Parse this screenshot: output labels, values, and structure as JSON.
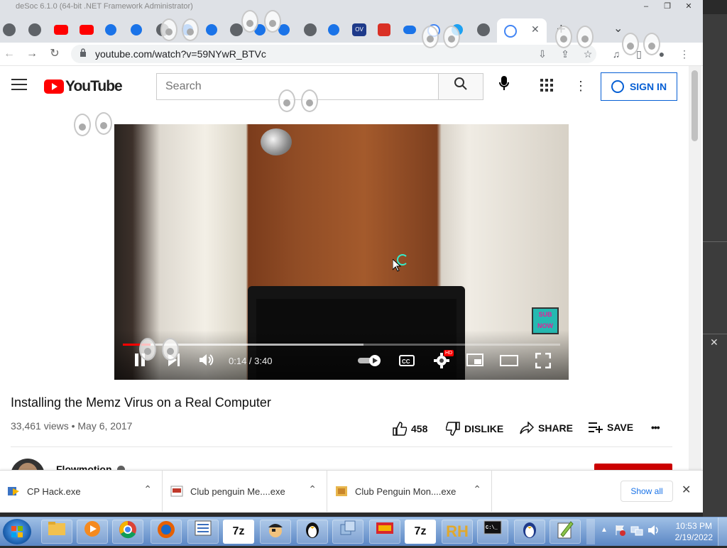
{
  "window": {
    "title": "deSoc 6.1.0 (64-bit .NET Framework Administrator)",
    "minimize": "–",
    "restore": "❐",
    "close": "✕"
  },
  "browser": {
    "new_tab": "+",
    "tab_search": "⌄",
    "tab_close": "✕",
    "back_icon": "←",
    "forward_icon": "→",
    "reload_icon": "↻",
    "url": "youtube.com/watch?v=59NYwR_BTVc",
    "lock_icon": "🔒"
  },
  "youtube": {
    "logo_text": "YouTube",
    "search_placeholder": "Search",
    "sign_in": "SIGN IN"
  },
  "video": {
    "current_time": "0:14",
    "duration": "3:40",
    "time_display": "0:14 / 3:40",
    "played_fraction": 0.064,
    "buffered_fraction": 0.55,
    "hd_badge": "HD",
    "badge_text": "SUB NOW"
  },
  "info": {
    "title": "Installing the Memz Virus on a Real Computer",
    "views_date": "33,461 views • May 6, 2017",
    "like_count": "458",
    "dislike_label": "DISLIKE",
    "share_label": "SHARE",
    "save_label": "SAVE",
    "more_label": "•••",
    "channel_name": "Flowmotion"
  },
  "downloads": {
    "items": [
      {
        "name": "CP Hack.exe"
      },
      {
        "name": "Club penguin Me....exe"
      },
      {
        "name": "Club Penguin Mon....exe"
      }
    ],
    "show_all": "Show all",
    "close": "✕"
  },
  "taskbar": {
    "apps": [
      "explorer",
      "media-player",
      "chrome",
      "firefox",
      "notepad",
      "7zip",
      "pirate",
      "penguin",
      "copy",
      "game",
      "7zip",
      "resource-hacker",
      "cmd",
      "penguin",
      "notepad-plus"
    ],
    "app_labels": {
      "sevenzip": "7z",
      "rh": "RH"
    },
    "time": "10:53 PM",
    "date": "2/19/2022"
  },
  "colors": {
    "youtube_red": "#ff0000",
    "link_blue": "#065fd4",
    "download_link": "#1a73e8"
  }
}
